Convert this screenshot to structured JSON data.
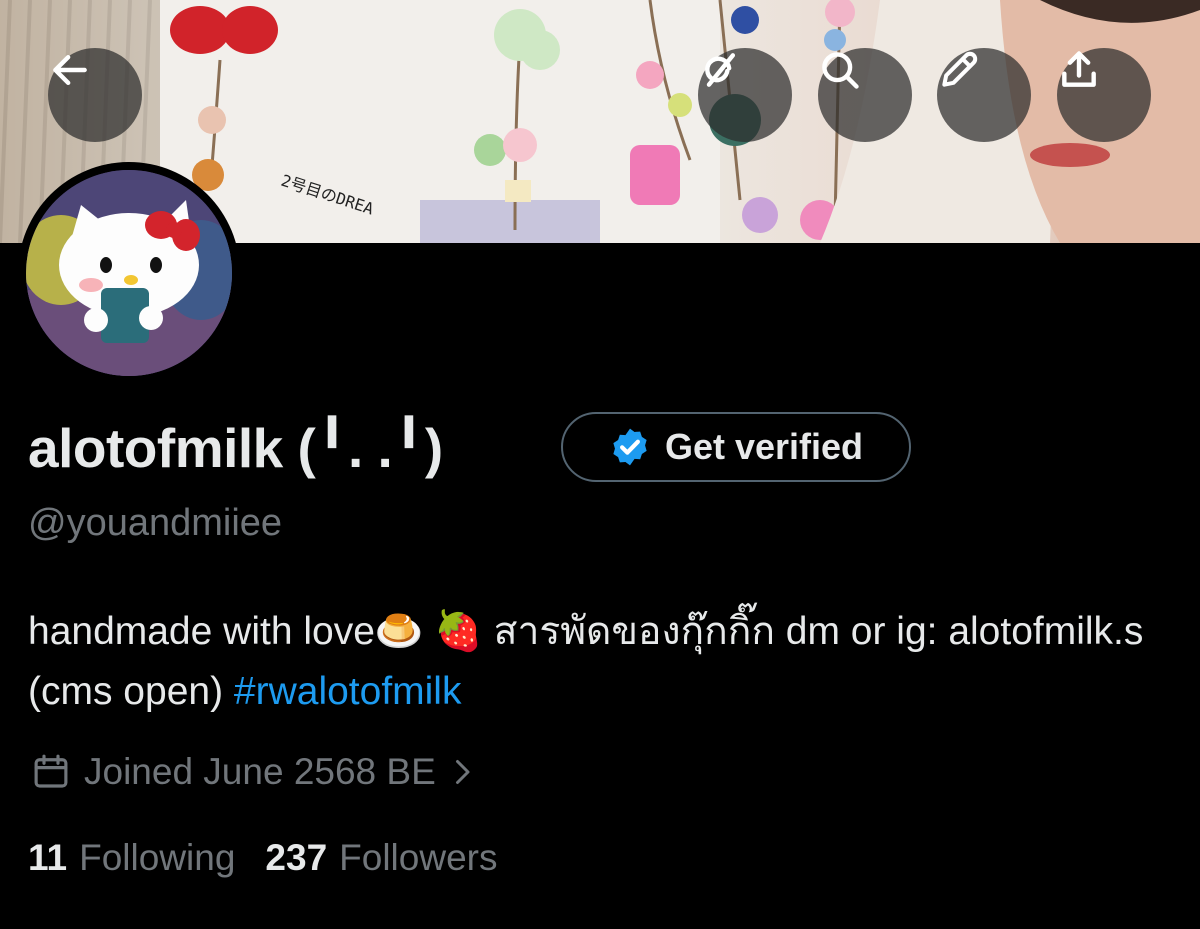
{
  "profile": {
    "display_name": "alotofmilk (╹. .╹)",
    "handle": "@youandmiiee",
    "bio_text": "handmade with love🍮 🍓  สารพัดของกุ๊กกิ๊ก dm or ig: alotofmilk.s (cms open) ",
    "bio_hashtag": "#rwalotofmilk",
    "joined": "Joined June 2568 BE",
    "following_count": "11",
    "following_label": "Following",
    "followers_count": "237",
    "followers_label": "Followers"
  },
  "actions": {
    "get_verified_label": "Get verified"
  },
  "icons": {
    "back": "back-arrow-icon",
    "grok": "grok-icon",
    "search": "search-icon",
    "edit": "pencil-icon",
    "share": "share-icon",
    "verified": "verified-badge-icon",
    "calendar": "calendar-icon",
    "chevron": "chevron-right-icon"
  },
  "colors": {
    "background": "#000000",
    "text_primary": "#e7e9ea",
    "text_secondary": "#71767b",
    "link": "#1d9bf0",
    "verified_badge": "#1d9bf0",
    "button_border": "#536471"
  }
}
